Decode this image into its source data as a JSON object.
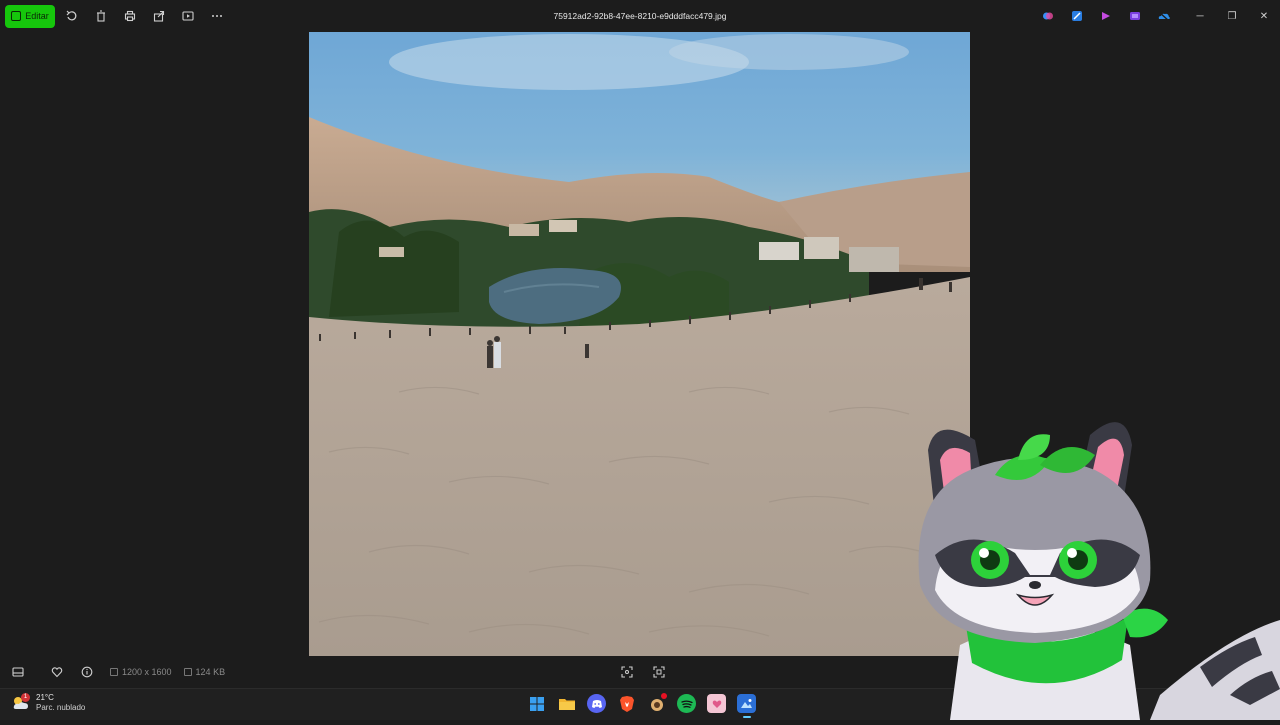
{
  "window": {
    "filename": "75912ad2-92b8-47ee-8210-e9dddfacc479.jpg"
  },
  "toolbar": {
    "edit_label": "Editar",
    "icons": [
      "rotate-icon",
      "delete-icon",
      "print-icon",
      "share-icon",
      "slideshow-icon",
      "more-icon"
    ]
  },
  "title_app_icons": [
    "copilot-icon",
    "designer-icon",
    "clipchamp-icon",
    "clipchamp-alt-icon",
    "onedrive-icon"
  ],
  "window_controls": [
    "minimize-icon",
    "restore-icon",
    "close-icon"
  ],
  "info_bar": {
    "dimensions": "1200 x 1600",
    "file_size": "124 KB"
  },
  "taskbar": {
    "weather_temp": "21°C",
    "weather_desc": "Parc. nublado",
    "weather_badge": "1",
    "apps": [
      "windows-start",
      "file-explorer",
      "discord",
      "brave-browser",
      "app-with-badge",
      "spotify",
      "app-pink",
      "photos"
    ]
  },
  "colors": {
    "accent_green": "#16c60c",
    "taskbar_active": "#60cdff"
  }
}
